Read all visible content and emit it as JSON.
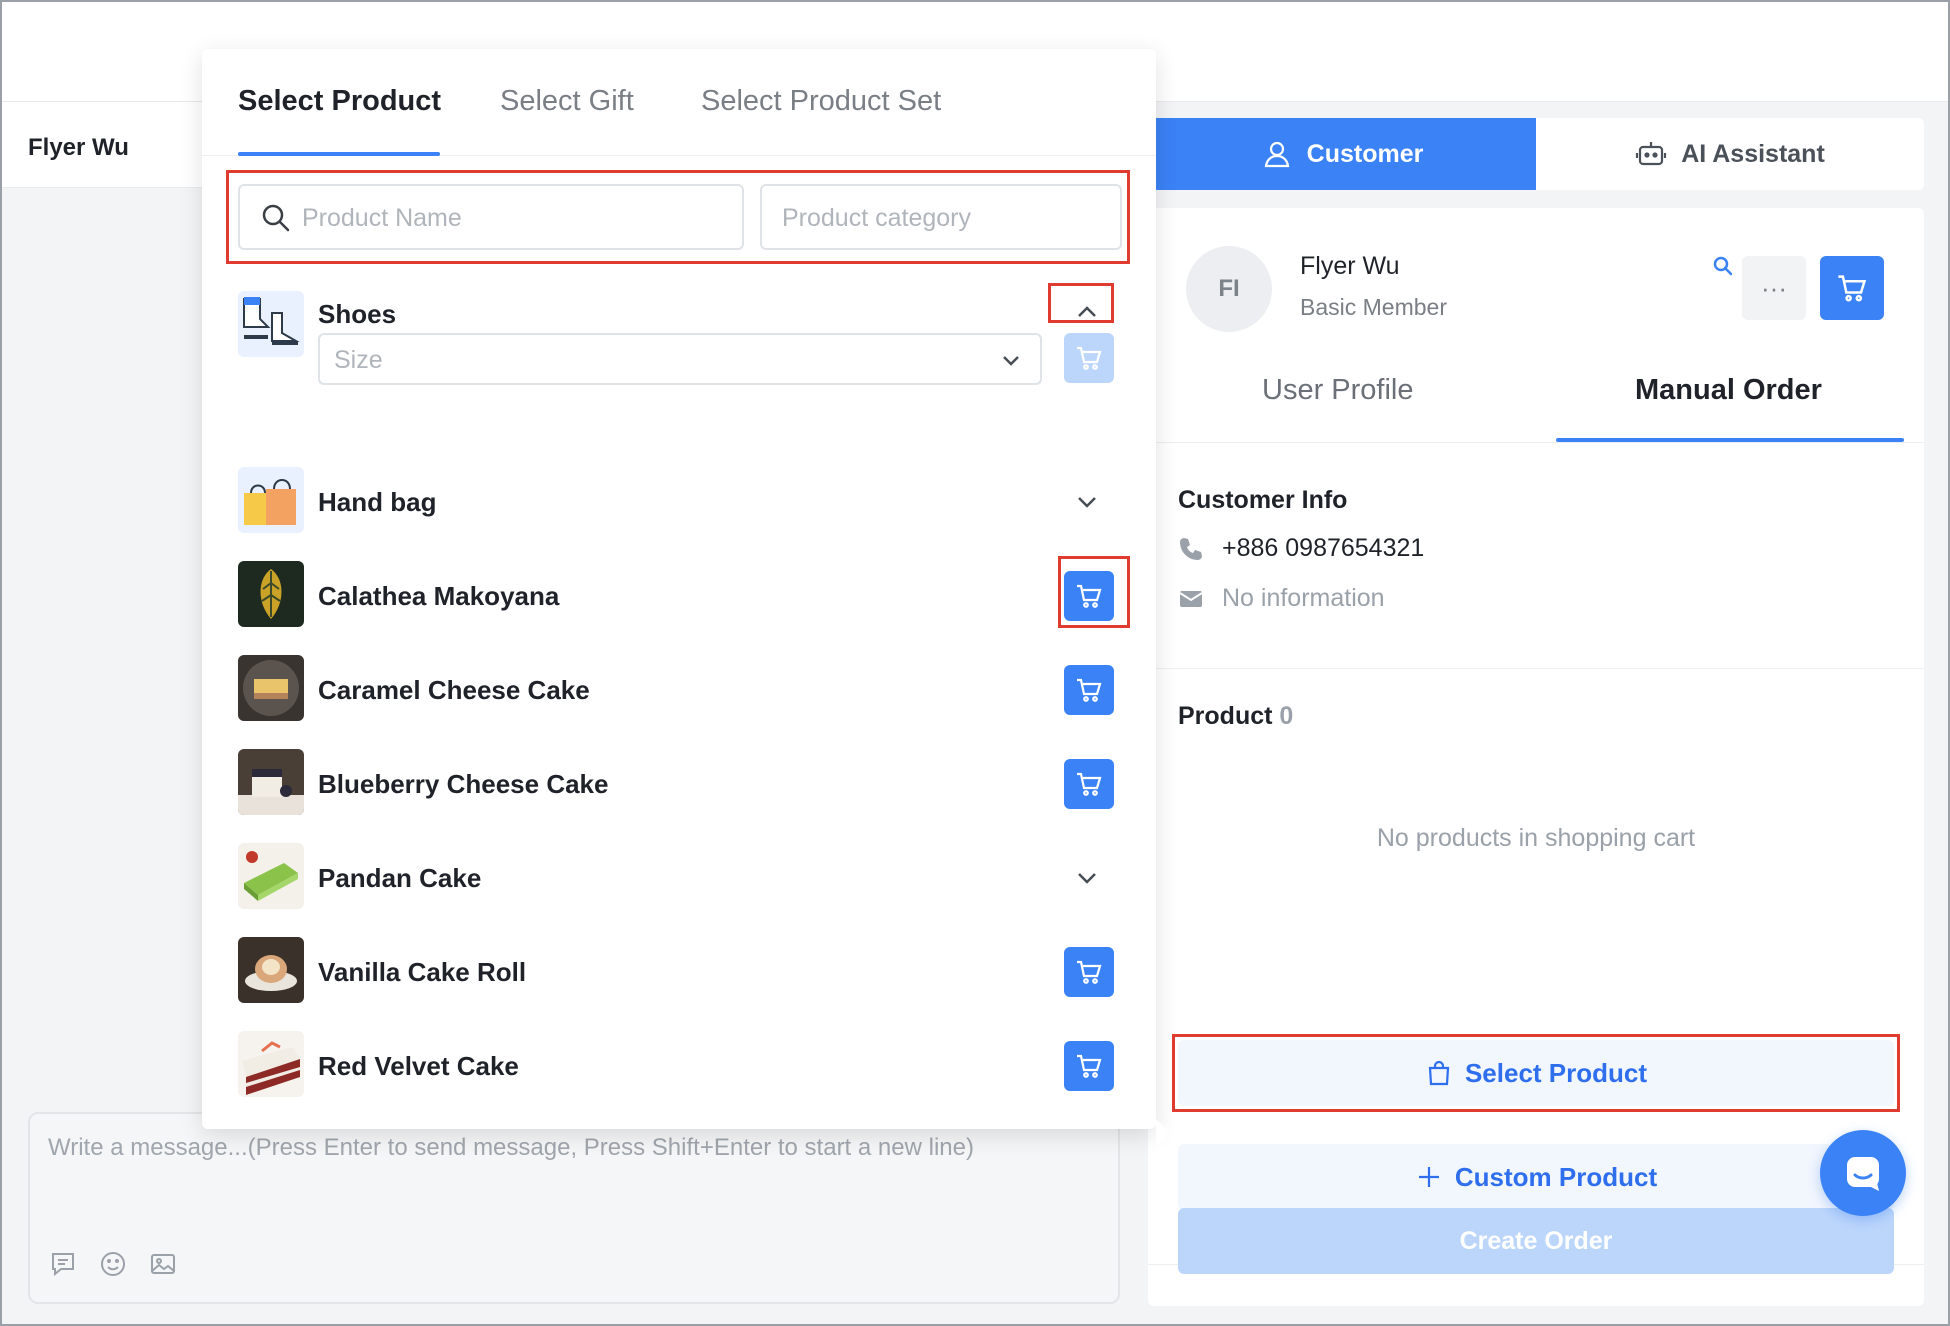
{
  "chat": {
    "contact_name": "Flyer Wu",
    "composer_placeholder": "Write a message...(Press Enter to send message, Press Shift+Enter to start a new line)",
    "tool_icons": [
      "template-icon",
      "emoji-icon",
      "image-icon"
    ]
  },
  "product_picker": {
    "tabs": [
      {
        "label": "Select Product",
        "active": true
      },
      {
        "label": "Select Gift",
        "active": false
      },
      {
        "label": "Select Product Set",
        "active": false
      }
    ],
    "search": {
      "name_placeholder": "Product Name",
      "category_placeholder": "Product category"
    },
    "items": [
      {
        "label": "Shoes",
        "control": "collapse",
        "size_placeholder": "Size"
      },
      {
        "label": "Hand bag",
        "control": "expand"
      },
      {
        "label": "Calathea Makoyana",
        "control": "cart"
      },
      {
        "label": "Caramel Cheese Cake",
        "control": "cart"
      },
      {
        "label": "Blueberry Cheese Cake",
        "control": "cart"
      },
      {
        "label": "Pandan Cake",
        "control": "expand"
      },
      {
        "label": "Vanilla Cake Roll",
        "control": "cart"
      },
      {
        "label": "Red Velvet Cake",
        "control": "cart"
      }
    ]
  },
  "side_panel": {
    "tabs": {
      "customer": "Customer",
      "ai": "AI Assistant"
    },
    "customer": {
      "initials": "FI",
      "name": "Flyer Wu",
      "tier": "Basic Member",
      "more_label": "···"
    },
    "sub_tabs": {
      "profile": "User Profile",
      "order": "Manual Order"
    },
    "info": {
      "title": "Customer Info",
      "phone": "+886 0987654321",
      "email": "No information"
    },
    "product": {
      "title": "Product",
      "count": "0",
      "empty": "No products in shopping cart",
      "select_label": "Select Product",
      "custom_label": "Custom Product",
      "create_label": "Create Order"
    }
  },
  "colors": {
    "accent": "#3b82f6",
    "highlight": "#e03b2f",
    "disabled": "#bcd6fb"
  }
}
